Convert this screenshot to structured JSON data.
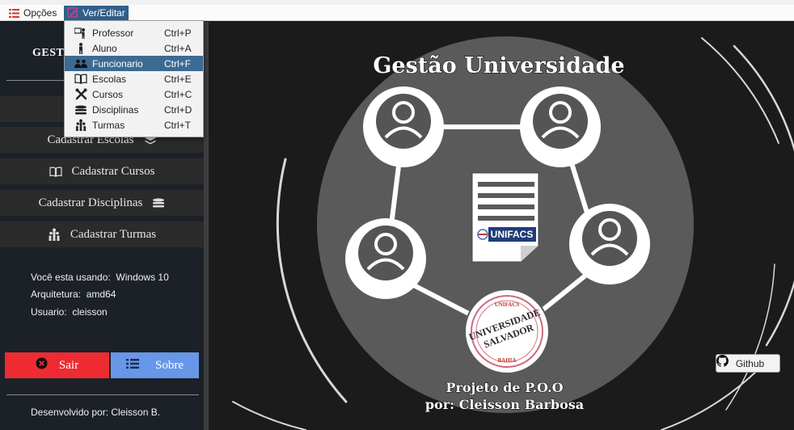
{
  "menubar": {
    "options_label": "Opções",
    "view_edit_label": "Ver/Editar",
    "icons": {
      "options": "list-icon",
      "view_edit": "edit-icon"
    }
  },
  "dropdown": {
    "items": [
      {
        "label": "Professor",
        "shortcut": "Ctrl+P",
        "icon": "professor-icon"
      },
      {
        "label": "Aluno",
        "shortcut": "Ctrl+A",
        "icon": "student-icon"
      },
      {
        "label": "Funcionario",
        "shortcut": "Ctrl+F",
        "icon": "staff-icon",
        "highlighted": true
      },
      {
        "label": "Escolas",
        "shortcut": "Ctrl+E",
        "icon": "book-open-icon"
      },
      {
        "label": "Cursos",
        "shortcut": "Ctrl+C",
        "icon": "tools-icon"
      },
      {
        "label": "Disciplinas",
        "shortcut": "Ctrl+D",
        "icon": "stack-icon"
      },
      {
        "label": "Turmas",
        "shortcut": "Ctrl+T",
        "icon": "group-icon"
      }
    ]
  },
  "sidebar": {
    "title": "GESTA",
    "buttons": [
      {
        "label": "",
        "icon": "hierarchy-icon"
      },
      {
        "label": "Cadastrar Escolas",
        "icon": "layers-icon"
      },
      {
        "label": "Cadastrar Cursos",
        "icon": "book-open-icon"
      },
      {
        "label": "Cadastrar Disciplinas",
        "icon": "stack-icon"
      },
      {
        "label": "Cadastrar Turmas",
        "icon": "group-icon"
      }
    ],
    "system_info": {
      "os_label": "Você esta usando:",
      "os_value": "Windows 10",
      "arch_label": "Arquitetura:",
      "arch_value": "amd64",
      "user_label": "Usuario:",
      "user_value": "cleisson"
    },
    "exit_label": "Sair",
    "about_label": "Sobre",
    "footer": "Desenvolvido por: Cleisson B."
  },
  "main": {
    "heading": "Gestão Universidade",
    "doc_logo": "UNIFACS",
    "seal_top": "UNIFACS",
    "seal_line1": "UNIVERSIDADE",
    "seal_line2": "SALVADOR",
    "seal_bottom": "BAHIA",
    "credit_line1": "Projeto de P.O.O",
    "credit_line2": "por: Cleisson Barbosa",
    "github_label": "Github"
  },
  "colors": {
    "sidebar_bg": "#1c2128",
    "exit_red": "#ef2b32",
    "about_blue": "#6896e8",
    "menu_highlight": "#3b6a92",
    "circle_gray": "#5a5a5a"
  }
}
